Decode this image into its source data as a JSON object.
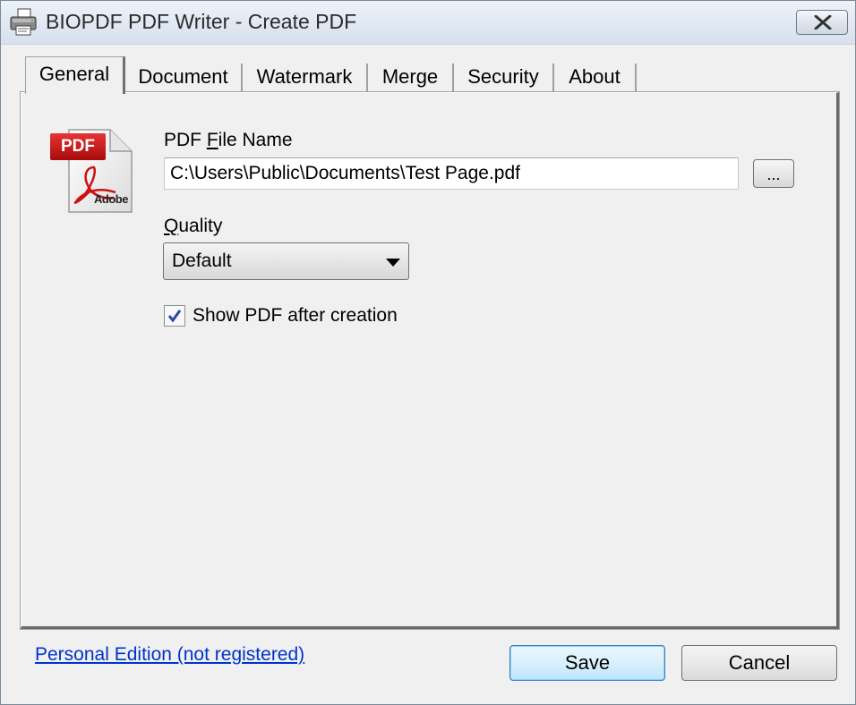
{
  "window": {
    "title": "BIOPDF PDF Writer - Create PDF",
    "app_icon": "printer-icon",
    "close_icon": "close-icon"
  },
  "tabs": [
    {
      "label": "General",
      "active": true
    },
    {
      "label": "Document",
      "active": false
    },
    {
      "label": "Watermark",
      "active": false
    },
    {
      "label": "Merge",
      "active": false
    },
    {
      "label": "Security",
      "active": false
    },
    {
      "label": "About",
      "active": false
    }
  ],
  "general": {
    "pdf_icon": {
      "name": "pdf-file-icon",
      "badge": "PDF",
      "brand": "Adobe"
    },
    "file_name_label_pre": "PDF ",
    "file_name_label_hotkey": "F",
    "file_name_label_post": "ile Name",
    "file_name_value": "C:\\Users\\Public\\Documents\\Test Page.pdf",
    "browse_label": "...",
    "quality_label_hotkey": "Q",
    "quality_label_post": "uality",
    "quality_value": "Default",
    "show_pdf_label": "Show PDF after creation",
    "show_pdf_checked": true
  },
  "footer": {
    "edition_link": "Personal Edition (not registered)",
    "save_label": "Save",
    "cancel_label": "Cancel"
  },
  "colors": {
    "link": "#0033cc",
    "pdf_red": "#cc1111",
    "default_button_border": "#3c7fb1"
  }
}
